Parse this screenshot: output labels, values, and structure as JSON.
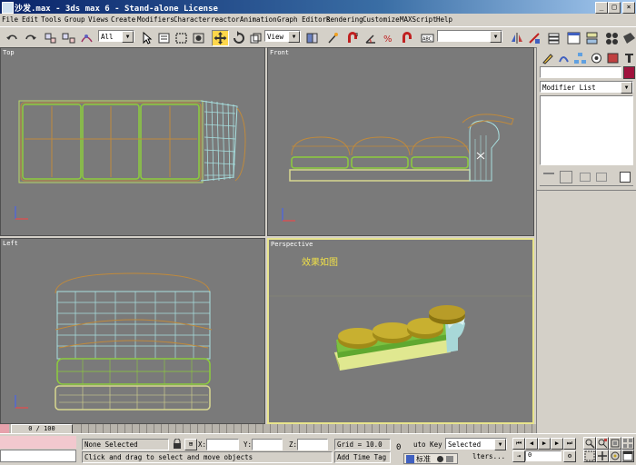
{
  "window": {
    "title": "沙发.max - 3ds max 6 - Stand-alone License",
    "buttons": {
      "minimize": "_",
      "maximize": "□",
      "close": "×"
    }
  },
  "menu": [
    "File",
    "Edit",
    "Tools",
    "Group",
    "Views",
    "Create",
    "Modifiers",
    "Character",
    "reactor",
    "Animation",
    "Graph Editors",
    "Rendering",
    "Customize",
    "MAXScript",
    "Help"
  ],
  "toolbar": {
    "selection_filter": "All",
    "reference_coord": "View",
    "named_selection": ""
  },
  "viewports": {
    "top": "Top",
    "front": "Front",
    "left": "Left",
    "perspective": "Perspective"
  },
  "annotation": "效果如图",
  "command_panel": {
    "modifier_list": "Modifier List",
    "name_field": "",
    "object_color": "#a0123c"
  },
  "timeline": {
    "frame": "0 / 100"
  },
  "status": {
    "selection": "None Selected",
    "prompt": "Click and drag to select and move objects",
    "x_label": "X:",
    "y_label": "Y:",
    "z_label": "Z:",
    "x_value": "",
    "y_value": "",
    "z_value": "",
    "grid": "Grid = 10.0",
    "add_time_tag": "Add Time Tag",
    "auto_key": "uto Key",
    "selected_set": "Selected",
    "filters": "lters...",
    "ime": "标准",
    "frame_value": "0",
    "key_counter": "0"
  },
  "colors": {
    "viewport_bg": "#7a7a7a",
    "active_border": "#e8e48c",
    "sofa_green": "#8ccc3c",
    "sofa_yellow": "#d8d890",
    "sofa_orange": "#c08a3c",
    "sofa_cyan": "#a8e0e0"
  }
}
